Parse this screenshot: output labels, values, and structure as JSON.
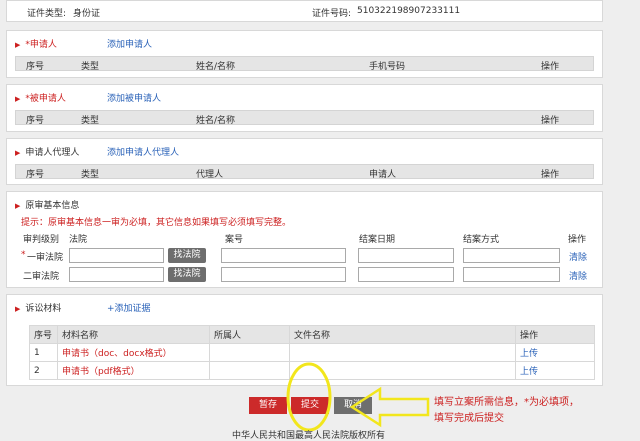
{
  "top_info": {
    "id_type_label": "证件类型:",
    "id_type_value": "身份证",
    "id_number_label": "证件号码:",
    "id_number_value": "510322198907233111"
  },
  "applicant": {
    "title": "*申请人",
    "add_link": "添加申请人",
    "columns": [
      "序号",
      "类型",
      "姓名/名称",
      "手机号码",
      "操作"
    ]
  },
  "respondent": {
    "title": "*被申请人",
    "add_link": "添加被申请人",
    "columns": [
      "序号",
      "类型",
      "姓名/名称",
      "操作"
    ]
  },
  "agent": {
    "title": "申请人代理人",
    "add_link": "添加申请人代理人",
    "columns": [
      "序号",
      "类型",
      "代理人",
      "申请人",
      "操作"
    ]
  },
  "original_case": {
    "title": "原审基本信息",
    "tip": "提示：原审基本信息一审为必填，其它信息如果填写必须填写完整。",
    "columns": [
      "审判级别",
      "法院",
      "案号",
      "结案日期",
      "结案方式",
      "操作"
    ],
    "rows": [
      {
        "level": "一审法院",
        "required": "*",
        "find_button": "找法院",
        "action": "清除"
      },
      {
        "level": "二审法院",
        "required": "",
        "find_button": "找法院",
        "action": "清除"
      }
    ]
  },
  "materials": {
    "title": "诉讼材料",
    "add_link": "+添加证据",
    "columns": [
      "序号",
      "材料名称",
      "所属人",
      "文件名称",
      "操作"
    ],
    "rows": [
      {
        "index": "1",
        "name": "申请书（doc、docx格式）",
        "owner": "",
        "file": "",
        "action": "上传"
      },
      {
        "index": "2",
        "name": "申请书（pdf格式）",
        "owner": "",
        "file": "",
        "action": "上传"
      }
    ]
  },
  "actions": {
    "save": "暂存",
    "submit": "提交",
    "cancel": "取消"
  },
  "annotation": {
    "line1": "填写立案所需信息，*为必填项，",
    "line2": "填写完成后提交"
  },
  "footer": {
    "text": "中华人民共和国最高人民法院版权所有"
  },
  "colors": {
    "accent_red": "#cc1f1f",
    "link_blue": "#2a62b8",
    "annotation_yellow": "#f2e61c"
  }
}
